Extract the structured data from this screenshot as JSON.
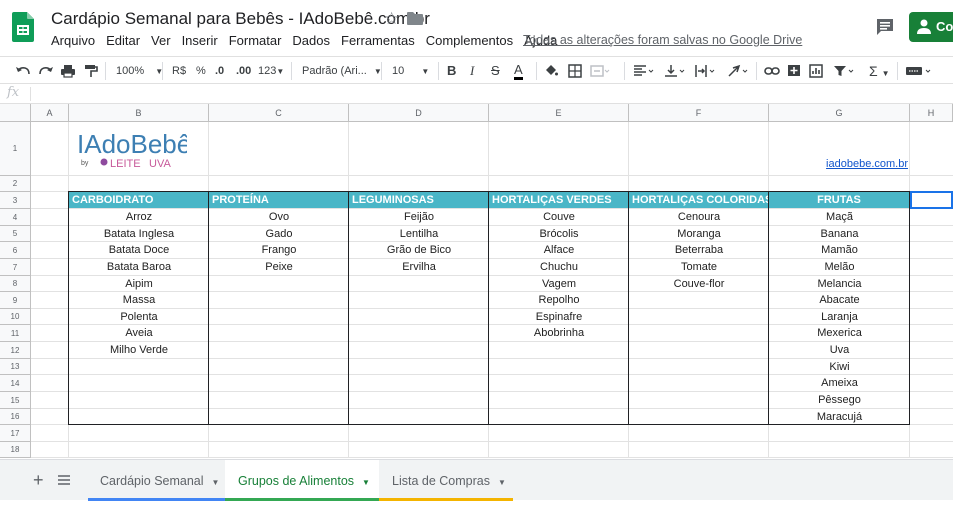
{
  "title_bar": {
    "doc_title": "Cardápio Semanal para Bebês - IAdoBebê.com.br",
    "save_status": "Todas as alterações foram salvas no Google Drive",
    "share_label": "Com"
  },
  "menu": [
    "Arquivo",
    "Editar",
    "Ver",
    "Inserir",
    "Formatar",
    "Dados",
    "Ferramentas",
    "Complementos",
    "Ajuda"
  ],
  "toolbar": {
    "zoom": "100%",
    "currency": "R$",
    "percent": "%",
    "decrease_decimal": ".0",
    "increase_decimal": ".00",
    "more_formats": "123",
    "font_family": "Padrão (Ari...",
    "font_size": "10",
    "bold": "B",
    "italic": "I",
    "strikethrough": "S",
    "text_color_letter": "A",
    "function": "Σ"
  },
  "formula_bar": {
    "fx": "fx"
  },
  "columns": [
    "A",
    "B",
    "C",
    "D",
    "E",
    "F",
    "G",
    "H"
  ],
  "rows": [
    "1",
    "2",
    "3",
    "4",
    "5",
    "6",
    "7",
    "8",
    "9",
    "10",
    "11",
    "12",
    "13",
    "14",
    "15",
    "16",
    "17",
    "18"
  ],
  "logo": {
    "main": "IAdoBebê",
    "by": "by",
    "sub1": "LEITE",
    "sub2": "UVA"
  },
  "link": "iadobebe.com.br",
  "table": {
    "headers": [
      "CARBOIDRATO",
      "PROTEÍNA",
      "LEGUMINOSAS",
      "HORTALIÇAS VERDES",
      "HORTALIÇAS COLORIDAS",
      "FRUTAS"
    ],
    "columns": [
      [
        "Arroz",
        "Batata Inglesa",
        "Batata Doce",
        "Batata Baroa",
        "Aipim",
        "Massa",
        "Polenta",
        "Aveia",
        "Milho Verde"
      ],
      [
        "Ovo",
        "Gado",
        "Frango",
        "Peixe"
      ],
      [
        "Feijão",
        "Lentilha",
        "Grão de Bico",
        "Ervilha"
      ],
      [
        "Couve",
        "Brócolis",
        "Alface",
        "Chuchu",
        "Vagem",
        "Repolho",
        "Espinafre",
        "Abobrinha"
      ],
      [
        "Cenoura",
        "Moranga",
        "Beterraba",
        "Tomate",
        "Couve-flor"
      ],
      [
        "Maçã",
        "Banana",
        "Mamão",
        "Melão",
        "Melancia",
        "Abacate",
        "Laranja",
        "Mexerica",
        "Uva",
        "Kiwi",
        "Ameixa",
        "Pêssego",
        "Maracujá"
      ]
    ],
    "header_color": "#4ab6c7"
  },
  "tabs": [
    {
      "label": "Cardápio Semanal",
      "active": false,
      "color": "#4285f4"
    },
    {
      "label": "Grupos de Alimentos",
      "active": true,
      "color": "#34a853"
    },
    {
      "label": "Lista de Compras",
      "active": false,
      "color": "#f4b400"
    }
  ],
  "colors": {
    "accent_green": "#188038",
    "active_tab_text": "#188038"
  }
}
